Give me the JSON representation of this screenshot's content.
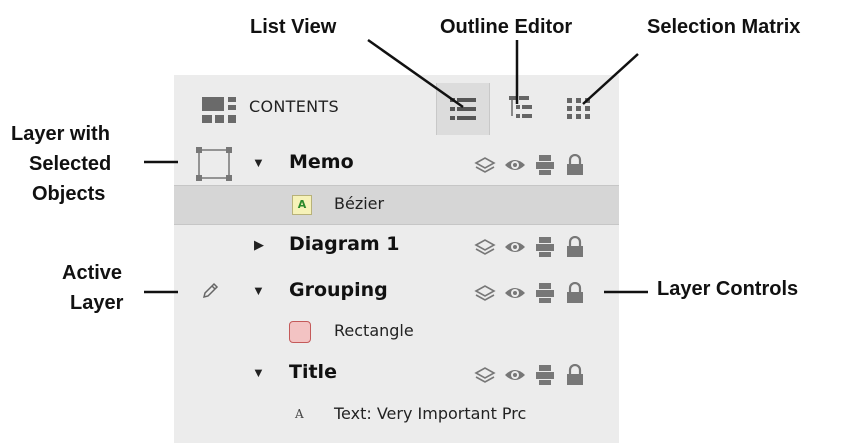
{
  "annotations": {
    "list_view": "List View",
    "outline_editor": "Outline Editor",
    "selection_matrix": "Selection Matrix",
    "layer_selected_1": "Layer with",
    "layer_selected_2": "Selected",
    "layer_selected_3": "Objects",
    "active_layer_1": "Active",
    "active_layer_2": "Layer",
    "layer_controls": "Layer Controls"
  },
  "panel": {
    "header_title": "CONTENTS",
    "tabs": [
      {
        "icon": "list-view-icon",
        "selected": true
      },
      {
        "icon": "outline-editor-icon",
        "selected": false
      },
      {
        "icon": "selection-matrix-icon",
        "selected": false
      }
    ],
    "rows": [
      {
        "type": "layer",
        "name": "Memo",
        "expanded": true,
        "indicator": "selected-objects-square"
      },
      {
        "type": "object",
        "name": "Bézier",
        "icon": "text-a-badge-icon",
        "highlighted": true
      },
      {
        "type": "layer",
        "name": "Diagram 1",
        "expanded": false
      },
      {
        "type": "layer",
        "name": "Grouping",
        "expanded": true,
        "indicator": "pencil-icon"
      },
      {
        "type": "object",
        "name": "Rectangle",
        "icon": "rounded-rect-icon"
      },
      {
        "type": "layer",
        "name": "Title",
        "expanded": true
      },
      {
        "type": "object",
        "name": "Text: Very Important Prc",
        "icon": "text-a-icon"
      }
    ],
    "layer_control_icons": [
      "layers-icon",
      "eye-icon",
      "printer-icon",
      "lock-icon"
    ]
  },
  "colors": {
    "panel_bg": "#ececec",
    "highlight_bg": "#d6d6d6",
    "rectangle_swatch": "#f3c3c3",
    "text_badge": "#f6f2b8"
  }
}
